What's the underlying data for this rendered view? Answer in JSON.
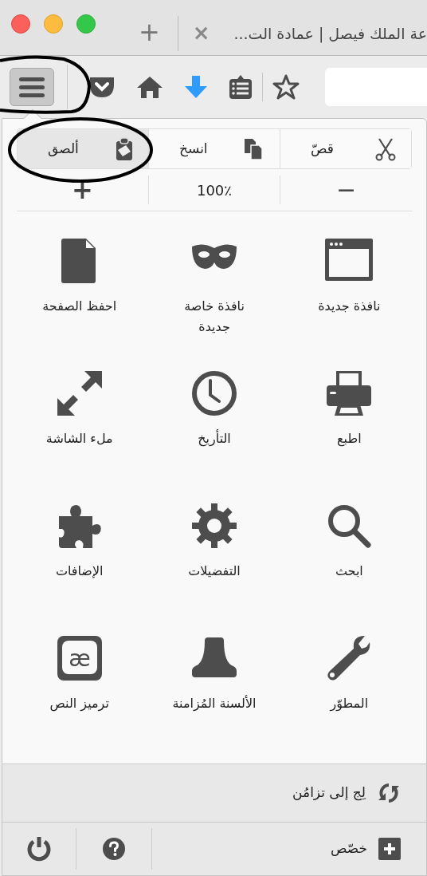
{
  "tab_bar": {
    "new_tab": "+",
    "close": "×",
    "tab_title": "عة الملك فيصل | عمادة الت..."
  },
  "toolbar": {
    "menu_button": {
      "pressed": true,
      "annotated": true
    },
    "buttons": [
      {
        "kind": "pocket"
      },
      {
        "kind": "home"
      },
      {
        "kind": "download"
      },
      {
        "kind": "reading-list"
      },
      {
        "kind": "star"
      }
    ]
  },
  "menu": {
    "edit_buttons": [
      {
        "kind": "cut",
        "label": "قصّ",
        "highlighted": false,
        "annotated": false
      },
      {
        "kind": "copy",
        "label": "انسخ",
        "highlighted": false,
        "annotated": false
      },
      {
        "kind": "paste",
        "label": "ألصق",
        "highlighted": true,
        "annotated": true
      }
    ],
    "zoom": {
      "out": "−",
      "level": "100٪",
      "in": "+"
    },
    "item_rows": [
      {
        "items": [
          {
            "kind": "new-window",
            "label": "نافذة جديدة"
          },
          {
            "kind": "private",
            "label": "نافذة خاصة جديدة"
          },
          {
            "kind": "save",
            "label": "احفظ الصفحة"
          }
        ]
      },
      {
        "items": [
          {
            "kind": "print",
            "label": "اطبع"
          },
          {
            "kind": "history",
            "label": "التأريخ"
          },
          {
            "kind": "fullscreen",
            "label": "ملء الشاشة"
          }
        ]
      },
      {
        "items": [
          {
            "kind": "search",
            "label": "ابحث"
          },
          {
            "kind": "preferences",
            "label": "التفضيلات"
          },
          {
            "kind": "addons",
            "label": "الإضافات"
          }
        ]
      },
      {
        "items": [
          {
            "kind": "developer",
            "label": "المطوّر"
          },
          {
            "kind": "synced-tabs",
            "label": "الألسنة المُزامنة"
          },
          {
            "kind": "encoding",
            "label": "ترميز النص",
            "symbol": "æ"
          }
        ]
      }
    ],
    "sync": {
      "label": "لِج إلى تزامُن"
    },
    "footer": {
      "customize": "خصّص"
    }
  }
}
